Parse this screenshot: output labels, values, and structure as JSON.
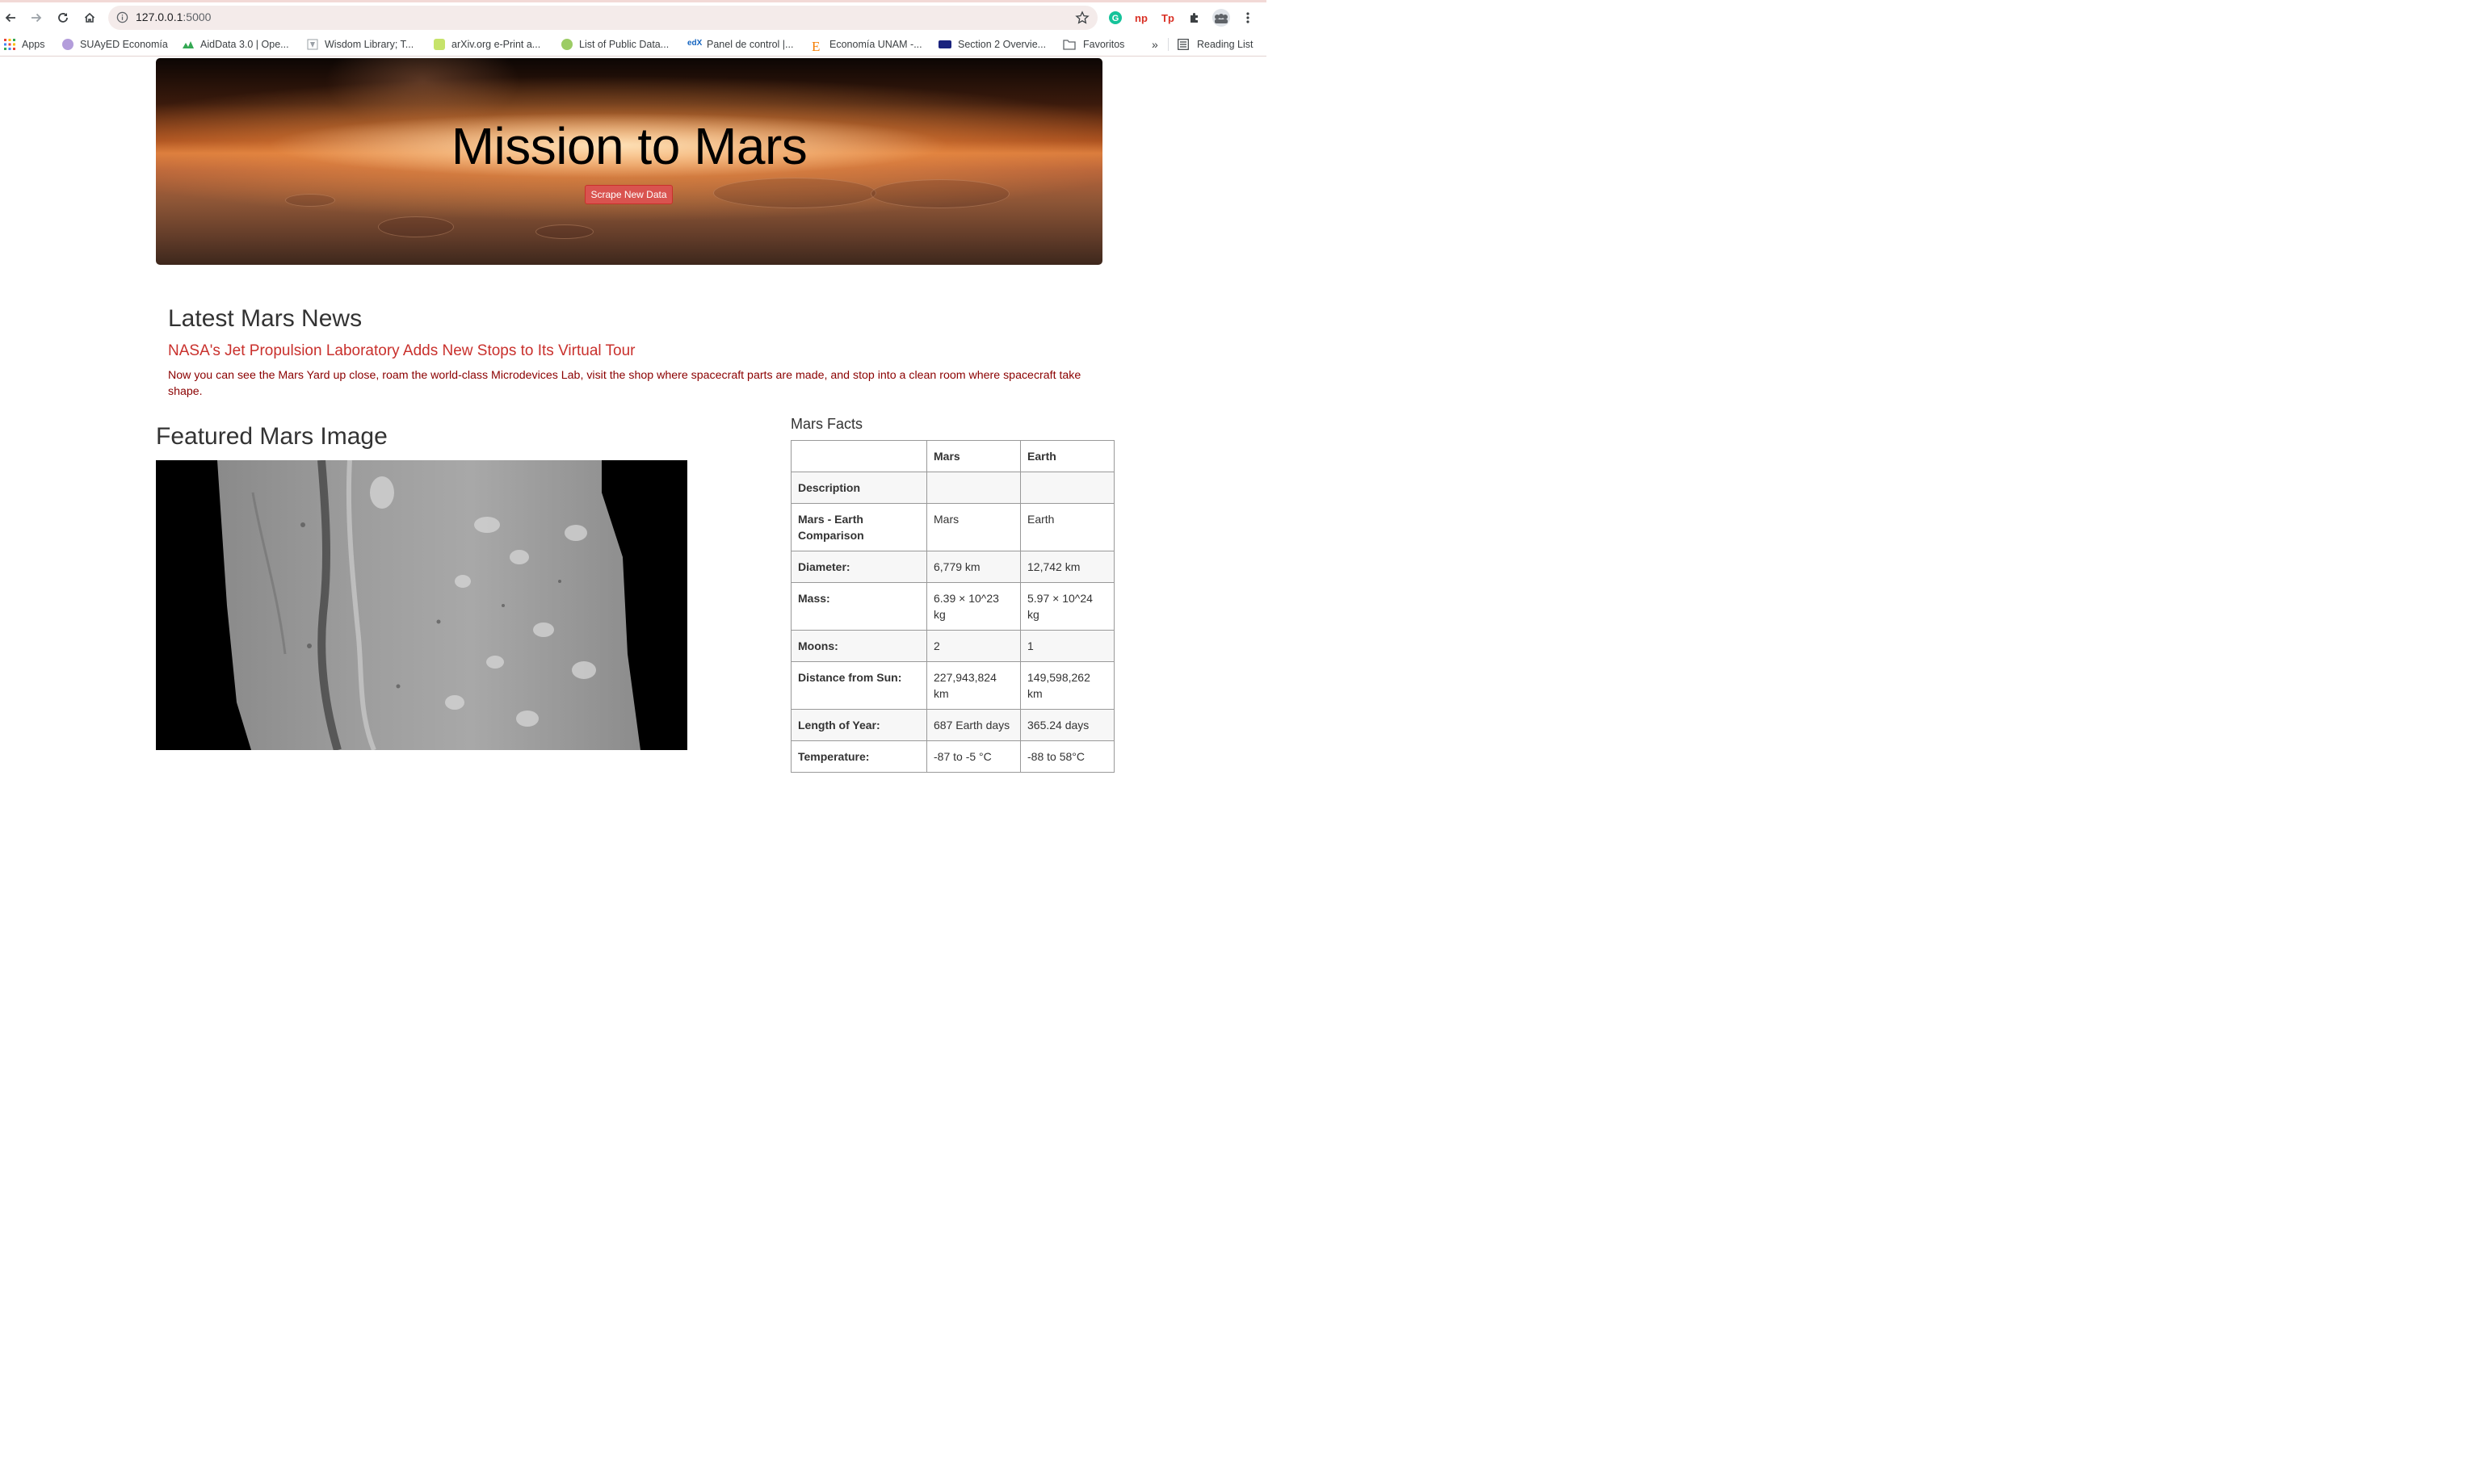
{
  "browser": {
    "url_host": "127.0.0.1",
    "url_port": ":5000",
    "bookmarks": [
      {
        "label": "Apps",
        "icon": "apps-grid-icon",
        "color": "#ea4335"
      },
      {
        "label": "SUAyED Economía",
        "icon": "suayed-icon",
        "color": "#8e6bd8"
      },
      {
        "label": "AidData 3.0 | Ope...",
        "icon": "aiddata-icon",
        "color": "#34a853"
      },
      {
        "label": "Wisdom Library; T...",
        "icon": "wisdom-icon",
        "color": "#9aa0a6"
      },
      {
        "label": "arXiv.org e-Print a...",
        "icon": "arxiv-icon",
        "color": "#7cb342"
      },
      {
        "label": "List of Public Data...",
        "icon": "ml-icon",
        "color": "#8bc34a"
      },
      {
        "label": "Panel de control |...",
        "icon": "edx-icon",
        "color": "#1565c0"
      },
      {
        "label": "Economía UNAM -...",
        "icon": "economia-icon",
        "color": "#f57c00"
      },
      {
        "label": "Section 2 Overvie...",
        "icon": "section-icon",
        "color": "#1a237e"
      },
      {
        "label": "Favoritos",
        "icon": "folder-icon",
        "color": "#5f6368"
      }
    ],
    "overflow": "»",
    "reading_list": "Reading List"
  },
  "jumbotron": {
    "title": "Mission to Mars",
    "button": "Scrape New Data"
  },
  "news": {
    "heading": "Latest Mars News",
    "title": "NASA's Jet Propulsion Laboratory Adds New Stops to Its Virtual Tour",
    "paragraph": "Now you can see the Mars Yard up close, roam the world-class Microdevices Lab, visit the shop where spacecraft parts are made, and stop into a clean room where spacecraft take shape."
  },
  "featured": {
    "heading": "Featured Mars Image"
  },
  "facts": {
    "heading": "Mars Facts",
    "columns": [
      "",
      "Mars",
      "Earth"
    ],
    "rows": [
      {
        "label": "Description",
        "mars": "",
        "earth": ""
      },
      {
        "label": "Mars - Earth Comparison",
        "mars": "Mars",
        "earth": "Earth"
      },
      {
        "label": "Diameter:",
        "mars": "6,779 km",
        "earth": "12,742 km"
      },
      {
        "label": "Mass:",
        "mars": "6.39 × 10^23 kg",
        "earth": "5.97 × 10^24 kg"
      },
      {
        "label": "Moons:",
        "mars": "2",
        "earth": "1"
      },
      {
        "label": "Distance from Sun:",
        "mars": "227,943,824 km",
        "earth": "149,598,262 km"
      },
      {
        "label": "Length of Year:",
        "mars": "687 Earth days",
        "earth": "365.24 days"
      },
      {
        "label": "Temperature:",
        "mars": "-87 to -5 °C",
        "earth": "-88 to 58°C"
      }
    ]
  }
}
